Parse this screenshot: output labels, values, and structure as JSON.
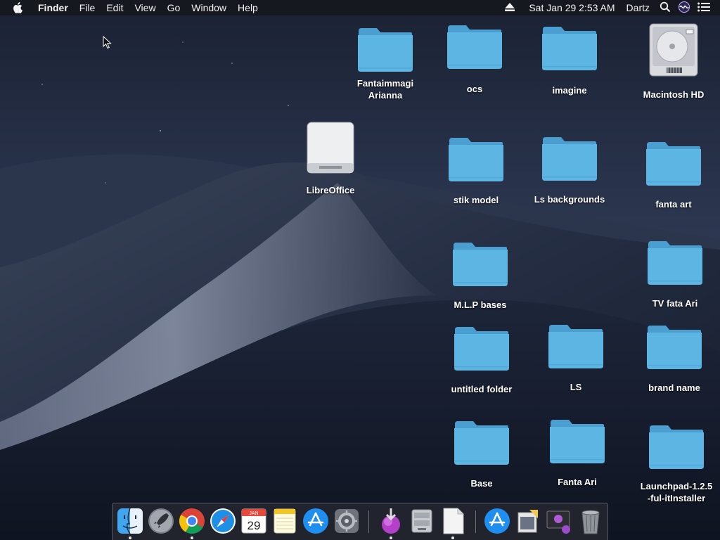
{
  "menubar": {
    "app_name": "Finder",
    "menus": [
      "File",
      "Edit",
      "View",
      "Go",
      "Window",
      "Help"
    ],
    "clock": "Sat Jan 29  2:53 AM",
    "user": "Dartz"
  },
  "desktop": {
    "icons": [
      {
        "label": "Fantaimmagi\nArianna",
        "icon": "folder-icon"
      },
      {
        "label": "ocs",
        "icon": "folder-icon"
      },
      {
        "label": "imagine",
        "icon": "folder-icon"
      },
      {
        "label": "Macintosh HD",
        "icon": "hard-drive-icon"
      },
      {
        "label": "LibreOffice",
        "icon": "external-drive-icon"
      },
      {
        "label": "stik  model",
        "icon": "folder-icon"
      },
      {
        "label": "Ls backgrounds",
        "icon": "folder-icon"
      },
      {
        "label": "fanta art",
        "icon": "folder-icon"
      },
      {
        "label": "M.L.P bases",
        "icon": "folder-icon"
      },
      {
        "label": "TV fata Ari",
        "icon": "folder-icon"
      },
      {
        "label": "untitled folder",
        "icon": "folder-icon"
      },
      {
        "label": "LS",
        "icon": "folder-icon"
      },
      {
        "label": "brand name",
        "icon": "folder-icon"
      },
      {
        "label": "Base",
        "icon": "folder-icon"
      },
      {
        "label": "Fanta Ari",
        "icon": "folder-icon"
      },
      {
        "label": "Launchpad-1.2.5\n-ful-itInstaller",
        "icon": "folder-icon"
      }
    ]
  },
  "dock": {
    "calendar": {
      "month": "JAN",
      "day": "29"
    },
    "items": [
      {
        "name": "finder-icon",
        "running": true
      },
      {
        "name": "launchpad-rocket-icon",
        "running": false
      },
      {
        "name": "chrome-icon",
        "running": true
      },
      {
        "name": "safari-compass-icon",
        "running": false
      },
      {
        "name": "calendar-icon",
        "running": false
      },
      {
        "name": "notes-icon",
        "running": false
      },
      {
        "name": "app-store-icon",
        "running": false
      },
      {
        "name": "system-preferences-gear-icon",
        "running": false
      },
      {
        "name": "installer-download-icon",
        "running": true
      },
      {
        "name": "disk-utility-icon",
        "running": false
      },
      {
        "name": "blank-document-icon",
        "running": true
      },
      {
        "name": "app-store-downloads-icon",
        "running": false
      },
      {
        "name": "preview-image-icon",
        "running": false
      },
      {
        "name": "utility-screen-icon",
        "running": false
      },
      {
        "name": "trash-icon",
        "running": false
      }
    ]
  },
  "colors": {
    "folder_body": "#5db5e3",
    "folder_tab": "#4a9fd0",
    "menubar_bg": "#16181e",
    "sky_top": "#1a2133",
    "dune_light": "#8a93a8"
  }
}
